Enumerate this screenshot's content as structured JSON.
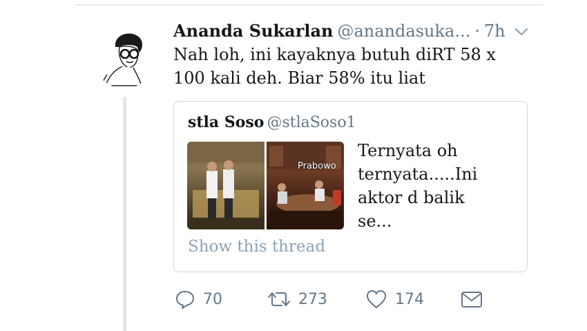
{
  "tweet": {
    "author_name": "Ananda Sukarlan",
    "author_handle": "@anandasuka...",
    "separator": "·",
    "time": "7h",
    "text": "Nah loh, ini kayaknya butuh diRT 58 x 100 kali deh. Biar 58% itu liat"
  },
  "quoted_tweet": {
    "author_name": "stla Soso",
    "author_handle": "@stlaSoso1",
    "media_caption": "Prabowo",
    "text": "Ternyata oh ternyata.....Ini aktor d balik se...",
    "show_thread_label": "Show this thread"
  },
  "actions": {
    "reply_count": "70",
    "retweet_count": "273",
    "like_count": "174"
  },
  "icons": [
    "reply-icon",
    "retweet-icon",
    "like-icon",
    "share-mail-icon",
    "chevron-down-icon"
  ],
  "colors": {
    "text": "#14171a",
    "muted": "#657786",
    "border": "#ccd6dd",
    "link_muted": "#8da2b4"
  }
}
